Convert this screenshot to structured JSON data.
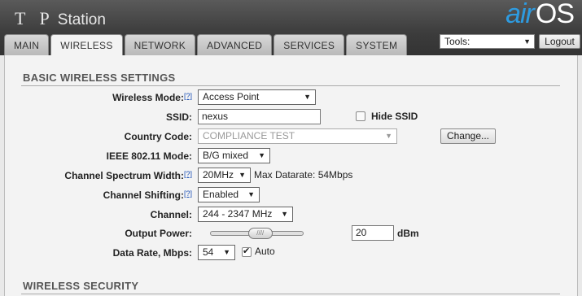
{
  "header": {
    "brand_tp": "T P",
    "brand_station": "Station",
    "logo_air": "air",
    "logo_os": "OS"
  },
  "tabs": [
    {
      "label": "MAIN"
    },
    {
      "label": "WIRELESS",
      "active": true
    },
    {
      "label": "NETWORK"
    },
    {
      "label": "ADVANCED"
    },
    {
      "label": "SERVICES"
    },
    {
      "label": "SYSTEM"
    }
  ],
  "toolbar": {
    "tools_value": "Tools:",
    "logout_label": "Logout"
  },
  "basic": {
    "title": "BASIC WIRELESS SETTINGS",
    "help": "[?]",
    "wireless_mode_label": "Wireless Mode:",
    "wireless_mode_value": "Access Point",
    "ssid_label": "SSID:",
    "ssid_value": "nexus",
    "hide_ssid_label": "Hide SSID",
    "hide_ssid_checked": false,
    "country_code_label": "Country Code:",
    "country_code_value": "COMPLIANCE TEST",
    "change_button": "Change...",
    "ieee_mode_label": "IEEE 802.11 Mode:",
    "ieee_mode_value": "B/G mixed",
    "channel_width_label": "Channel Spectrum Width:",
    "channel_width_value": "20MHz",
    "max_datarate": "Max Datarate: 54Mbps",
    "channel_shifting_label": "Channel Shifting:",
    "channel_shifting_value": "Enabled",
    "channel_label": "Channel:",
    "channel_value": "244 - 2347 MHz",
    "output_power_label": "Output Power:",
    "output_power_value": "20",
    "output_power_unit": "dBm",
    "output_power_fraction": 0.55,
    "data_rate_label": "Data Rate, Mbps:",
    "data_rate_value": "54",
    "auto_label": "Auto",
    "auto_checked": true
  },
  "security": {
    "title": "WIRELESS SECURITY"
  },
  "icons": {
    "dropdown": "chevron-down-icon",
    "slider_grip": "grip-icon",
    "check": "check-icon"
  },
  "colors": {
    "logo_blue": "#2e9be0",
    "header_dark": "#3c3c3c",
    "panel_bg": "#f3f3f3"
  }
}
